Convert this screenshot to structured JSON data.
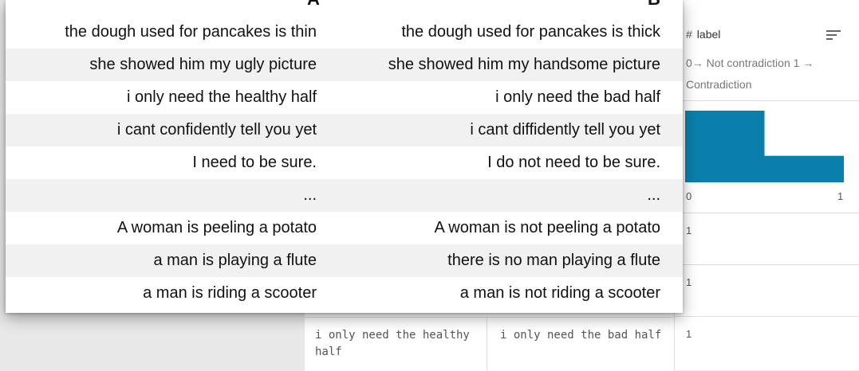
{
  "table": {
    "headers": {
      "a": "A",
      "b": "B"
    },
    "rows": [
      {
        "a": "the dough used for pancakes is thin",
        "b": "the dough used for pancakes is thick"
      },
      {
        "a": "she showed him my ugly picture",
        "b": "she showed him my handsome picture"
      },
      {
        "a": "i only need the healthy half",
        "b": "i only need the bad half"
      },
      {
        "a": "i cant confidently tell you yet",
        "b": "i cant diffidently tell you yet"
      },
      {
        "a": "I need to be sure.",
        "b": "I do not need to be sure."
      },
      {
        "a": "...",
        "b": "..."
      },
      {
        "a": "A woman is peeling a potato",
        "b": "A woman is not peeling a potato"
      },
      {
        "a": "a man is playing a flute",
        "b": "there is no man playing a flute"
      },
      {
        "a": "a man is riding a scooter",
        "b": "a man is not riding a scooter"
      }
    ]
  },
  "label_column": {
    "type_symbol": "#",
    "title": "label",
    "description": "0→ Not contradiction 1 → Contradiction",
    "values": [
      "1",
      "1",
      "1"
    ]
  },
  "background_row": {
    "a": "i only need the healthy half",
    "b": "i only need the bad half"
  },
  "chart_data": {
    "type": "bar",
    "categories": [
      "0",
      "1"
    ],
    "values": [
      0.73,
      0.27
    ],
    "tick_labels": [
      "0",
      "1"
    ],
    "ylim": [
      0,
      0.73
    ],
    "bar_color": "#0b7fab",
    "grid": false
  }
}
